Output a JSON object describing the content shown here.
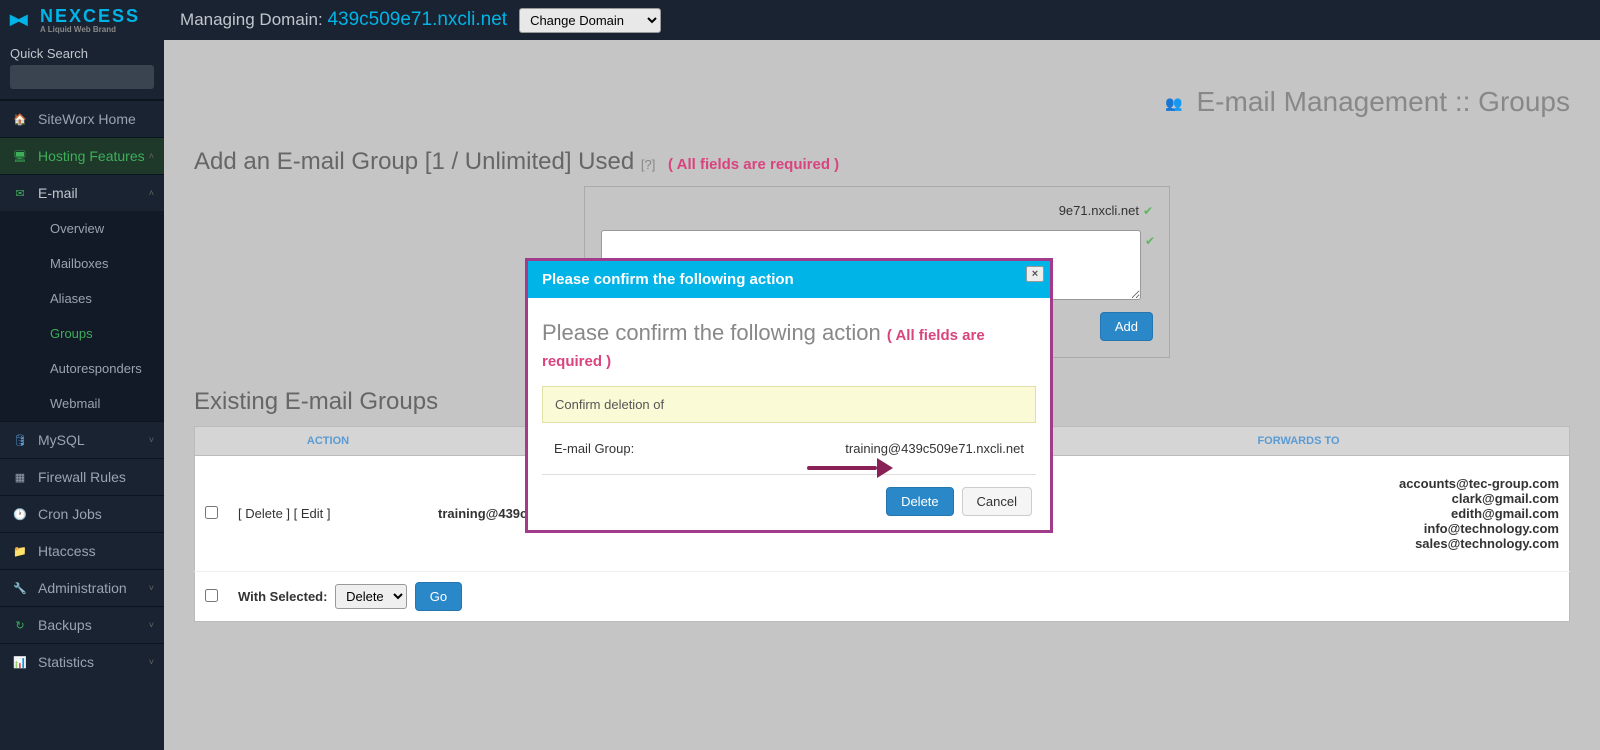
{
  "brand": {
    "name": "NEXCESS",
    "tagline": "A Liquid Web Brand"
  },
  "header": {
    "managing_label": "Managing Domain:",
    "domain": "439c509e71.nxcli.net",
    "change_domain": "Change Domain"
  },
  "sidebar": {
    "search_label": "Quick Search",
    "items": {
      "home": "SiteWorx Home",
      "hosting": "Hosting Features",
      "email": "E-mail",
      "overview": "Overview",
      "mailboxes": "Mailboxes",
      "aliases": "Aliases",
      "groups": "Groups",
      "autoresponders": "Autoresponders",
      "webmail": "Webmail",
      "mysql": "MySQL",
      "firewall": "Firewall Rules",
      "cron": "Cron Jobs",
      "htaccess": "Htaccess",
      "admin": "Administration",
      "backups": "Backups",
      "stats": "Statistics"
    }
  },
  "page": {
    "title": "E-mail Management :: Groups",
    "add_title": "Add an E-mail Group [1 / Unlimited] Used",
    "help": "[?]",
    "req": "( All fields are required )",
    "domain_suffix": "9e71.nxcli.net",
    "add_btn": "Add",
    "existing_title": "Existing E-mail Groups"
  },
  "table": {
    "headers": {
      "action": "ACTION",
      "forwards": "FORWARDS TO"
    },
    "row": {
      "delete": "[ Delete ]",
      "edit": "[ Edit ]",
      "group": "training@439c509e71.nxcli.net",
      "forwards": [
        "accounts@tec-group.com",
        "clark@gmail.com",
        "edith@gmail.com",
        "info@technology.com",
        "sales@technology.com"
      ]
    },
    "with_selected": "With Selected:",
    "ws_option": "Delete",
    "go": "Go"
  },
  "modal": {
    "title": "Please confirm the following action",
    "subtitle": "Please confirm the following action",
    "req": "( All fields are required )",
    "confirm_text": "Confirm deletion of",
    "label": "E-mail Group:",
    "value": "training@439c509e71.nxcli.net",
    "delete": "Delete",
    "cancel": "Cancel",
    "close": "×"
  }
}
